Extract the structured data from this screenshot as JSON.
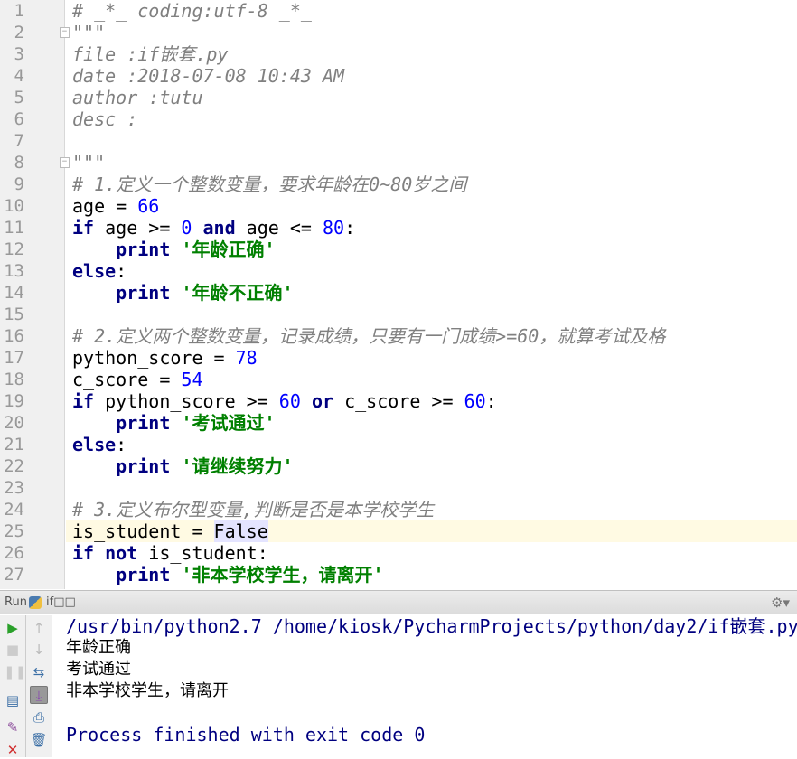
{
  "editor": {
    "current_line": 25,
    "fold_lines": [
      2,
      8
    ],
    "lines": [
      [
        [
          "comment",
          "# _*_ coding:utf-8 _*_"
        ]
      ],
      [
        [
          "doc",
          "\"\"\""
        ]
      ],
      [
        [
          "doc",
          "file :if嵌套.py"
        ]
      ],
      [
        [
          "doc",
          "date :2018-07-08 10:43 AM"
        ]
      ],
      [
        [
          "doc",
          "author :tutu"
        ]
      ],
      [
        [
          "doc",
          "desc :"
        ]
      ],
      [],
      [
        [
          "doc",
          "\"\"\""
        ]
      ],
      [
        [
          "comment",
          "# 1.定义一个整数变量，要求年龄在0~80岁之间"
        ]
      ],
      [
        [
          "plain",
          "age = "
        ],
        [
          "num",
          "66"
        ]
      ],
      [
        [
          "kw",
          "if"
        ],
        [
          "plain",
          " age >= "
        ],
        [
          "num",
          "0"
        ],
        [
          "plain",
          " "
        ],
        [
          "kw",
          "and"
        ],
        [
          "plain",
          " age <= "
        ],
        [
          "num",
          "80"
        ],
        [
          "plain",
          ":"
        ]
      ],
      [
        [
          "plain",
          "    "
        ],
        [
          "kw",
          "print"
        ],
        [
          "plain",
          " "
        ],
        [
          "str",
          "'年龄正确'"
        ]
      ],
      [
        [
          "kw",
          "else"
        ],
        [
          "plain",
          ":"
        ]
      ],
      [
        [
          "plain",
          "    "
        ],
        [
          "kw",
          "print"
        ],
        [
          "plain",
          " "
        ],
        [
          "str",
          "'年龄不正确'"
        ]
      ],
      [],
      [
        [
          "comment",
          "# 2.定义两个整数变量，记录成绩，只要有一门成绩>=60，就算考试及格"
        ]
      ],
      [
        [
          "plain",
          "python_score = "
        ],
        [
          "num",
          "78"
        ]
      ],
      [
        [
          "plain",
          "c_score = "
        ],
        [
          "num",
          "54"
        ]
      ],
      [
        [
          "kw",
          "if"
        ],
        [
          "plain",
          " python_score >= "
        ],
        [
          "num",
          "60"
        ],
        [
          "plain",
          " "
        ],
        [
          "kw",
          "or"
        ],
        [
          "plain",
          " c_score >= "
        ],
        [
          "num",
          "60"
        ],
        [
          "plain",
          ":"
        ]
      ],
      [
        [
          "plain",
          "    "
        ],
        [
          "kw",
          "print"
        ],
        [
          "plain",
          " "
        ],
        [
          "str",
          "'考试通过'"
        ]
      ],
      [
        [
          "kw",
          "else"
        ],
        [
          "plain",
          ":"
        ]
      ],
      [
        [
          "plain",
          "    "
        ],
        [
          "kw",
          "print"
        ],
        [
          "plain",
          " "
        ],
        [
          "str",
          "'请继续努力'"
        ]
      ],
      [],
      [
        [
          "comment",
          "# 3.定义布尔型变量,判断是否是本学校学生"
        ]
      ],
      [
        [
          "plain",
          "is_student = "
        ],
        [
          "hl",
          "False"
        ]
      ],
      [
        [
          "kw",
          "if not"
        ],
        [
          "plain",
          " is_student:"
        ]
      ],
      [
        [
          "plain",
          "    "
        ],
        [
          "kw",
          "print"
        ],
        [
          "plain",
          " "
        ],
        [
          "str",
          "'非本学校学生，请离开'"
        ]
      ]
    ]
  },
  "run_panel": {
    "label": "Run",
    "tab": "if□□",
    "settings_icon": "gear-icon",
    "left_tools": [
      "run-icon",
      "stop-icon",
      "pause-icon",
      "layout-icon",
      "pin-icon",
      "close-icon"
    ],
    "right_tools": [
      "up-icon",
      "down-icon",
      "soft-wrap-icon",
      "scroll-to-end-icon",
      "print-icon",
      "trash-icon"
    ]
  },
  "console": {
    "command": "/usr/bin/python2.7 /home/kiosk/PycharmProjects/python/day2/if嵌套.py",
    "output": [
      "年龄正确",
      "考试通过",
      "非本学校学生，请离开"
    ],
    "exit_message": "Process finished with exit code 0"
  }
}
